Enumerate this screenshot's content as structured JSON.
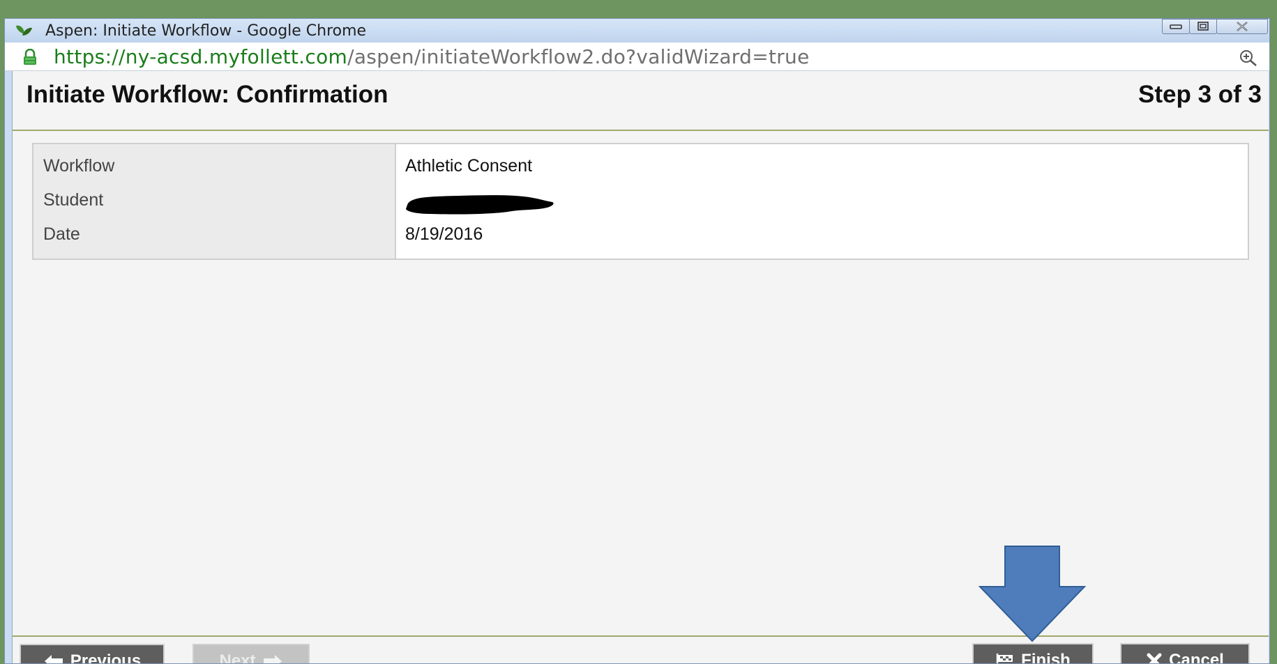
{
  "window": {
    "title": "Aspen: Initiate Workflow - Google Chrome"
  },
  "address": {
    "scheme": "https://",
    "host": "ny-acsd.myfollett.com",
    "path": "/aspen/initiateWorkflow2.do?validWizard=true"
  },
  "page": {
    "title": "Initiate Workflow: Confirmation",
    "step": "Step 3 of 3"
  },
  "details": {
    "rows": [
      {
        "label": "Workflow",
        "value": "Athletic Consent"
      },
      {
        "label": "Student",
        "value": ""
      },
      {
        "label": "Date",
        "value": "8/19/2016"
      }
    ]
  },
  "buttons": {
    "previous": "Previous",
    "next": "Next",
    "finish": "Finish",
    "cancel": "Cancel"
  },
  "colors": {
    "accent_rule": "#a0a86a",
    "button_dark": "#5e5e5e",
    "button_disabled": "#c3c3c3",
    "annotation_arrow": "#4f7dbc",
    "url_host": "#1a7d1a"
  },
  "icons": {
    "app": "aspen-leaf-icon",
    "lock": "lock-icon",
    "zoom": "zoom-in-icon",
    "previous": "arrow-left-icon",
    "next": "arrow-right-icon",
    "finish": "flag-icon",
    "cancel": "x-icon"
  }
}
